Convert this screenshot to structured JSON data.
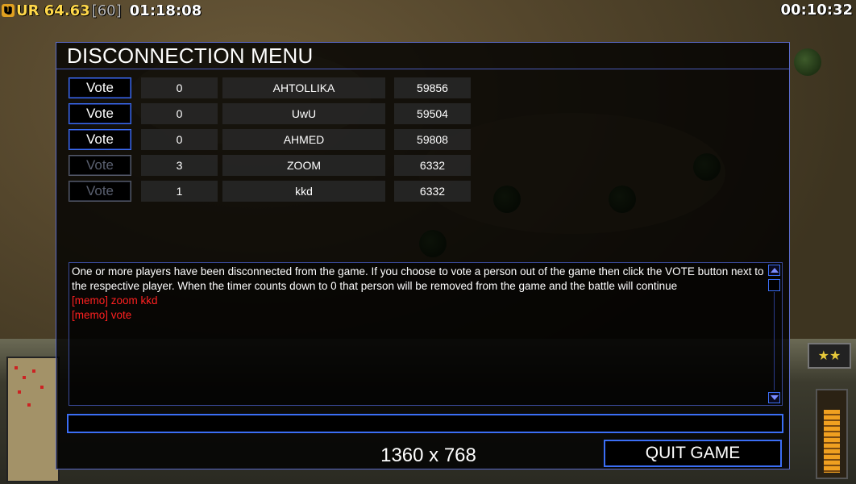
{
  "hud": {
    "fps_label": "UR 64.63",
    "fps_bracket": "[60]",
    "game_time": "01:18:08",
    "session_time": "00:10:32"
  },
  "dialog": {
    "title": "DISCONNECTION MENU",
    "rows": [
      {
        "vote": "Vote",
        "enabled": true,
        "count": "0",
        "name": "AHTOLLIKA",
        "ping": "59856"
      },
      {
        "vote": "Vote",
        "enabled": true,
        "count": "0",
        "name": "UwU",
        "ping": "59504"
      },
      {
        "vote": "Vote",
        "enabled": true,
        "count": "0",
        "name": "AHMED",
        "ping": "59808"
      },
      {
        "vote": "Vote",
        "enabled": false,
        "count": "3",
        "name": "ZOOM",
        "ping": "6332"
      },
      {
        "vote": "Vote",
        "enabled": false,
        "count": "1",
        "name": "kkd",
        "ping": "6332"
      }
    ],
    "messages": {
      "info": "One or more players have been disconnected from the game. If you choose to vote a person out of the game then click the VOTE button next to the respective player. When the timer counts down to 0 that person will be removed from the game and the battle will continue",
      "memo1": "[memo] zoom kkd",
      "memo2": "[memo] vote"
    },
    "chat_input_value": "",
    "resolution": "1360 x 768",
    "quit_label": "QUIT GAME"
  },
  "colors": {
    "accent_border": "#3b6ef5",
    "memo_text": "#ff2020",
    "fps_yellow": "#ffd84a"
  }
}
